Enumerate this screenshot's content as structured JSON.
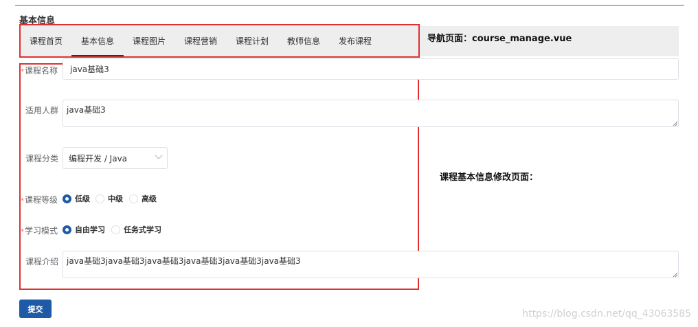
{
  "section_title": "基本信息",
  "nav": {
    "tabs": [
      {
        "label": "课程首页",
        "active": false
      },
      {
        "label": "基本信息",
        "active": true
      },
      {
        "label": "课程图片",
        "active": false
      },
      {
        "label": "课程营销",
        "active": false
      },
      {
        "label": "课程计划",
        "active": false
      },
      {
        "label": "教师信息",
        "active": false
      },
      {
        "label": "发布课程",
        "active": false
      }
    ]
  },
  "annotations": {
    "nav_note": "导航页面：course_manage.vue",
    "form_note": "课程基本信息修改页面："
  },
  "form": {
    "required_mark": "*",
    "course_name": {
      "label": "课程名称",
      "value": "java基础3",
      "required": true
    },
    "audience": {
      "label": "适用人群",
      "value": "java基础3"
    },
    "category": {
      "label": "课程分类",
      "value": "编程开发 / Java"
    },
    "grade": {
      "label": "课程等级",
      "required": true,
      "options": [
        {
          "label": "低级",
          "checked": true
        },
        {
          "label": "中级",
          "checked": false
        },
        {
          "label": "高级",
          "checked": false
        }
      ]
    },
    "study_mode": {
      "label": "学习模式",
      "required": true,
      "options": [
        {
          "label": "自由学习",
          "checked": true
        },
        {
          "label": "任务式学习",
          "checked": false
        }
      ]
    },
    "description": {
      "label": "课程介绍",
      "value": "java基础3java基础3java基础3java基础3java基础3java基础3"
    }
  },
  "submit_label": "提交",
  "watermark": "https://blog.csdn.net/qq_43063585",
  "colors": {
    "accent": "#1f5aa6",
    "annotation_border": "#e03030",
    "required": "#f56c6c"
  }
}
